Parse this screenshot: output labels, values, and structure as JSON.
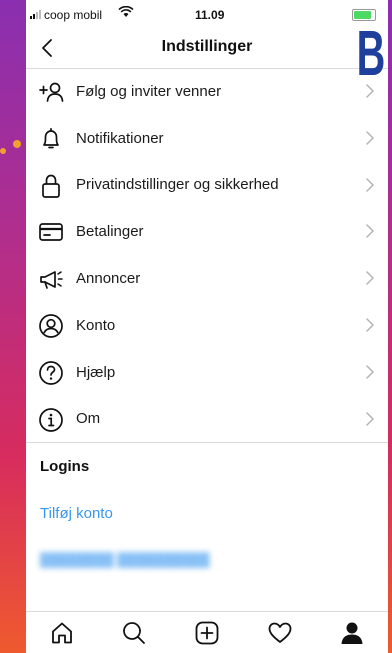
{
  "status_bar": {
    "carrier": "coop mobil",
    "time": "11.09"
  },
  "header": {
    "title": "Indstillinger"
  },
  "menu": [
    {
      "label": "Følg og inviter venner",
      "icon": "add-person-icon"
    },
    {
      "label": "Notifikationer",
      "icon": "bell-icon"
    },
    {
      "label": "Privatindstillinger og sikkerhed",
      "icon": "lock-icon"
    },
    {
      "label": "Betalinger",
      "icon": "credit-card-icon"
    },
    {
      "label": "Annoncer",
      "icon": "megaphone-icon"
    },
    {
      "label": "Konto",
      "icon": "account-icon"
    },
    {
      "label": "Hjælp",
      "icon": "help-icon"
    },
    {
      "label": "Om",
      "icon": "info-icon"
    }
  ],
  "logins": {
    "heading": "Logins",
    "add_account": "Tilføj konto"
  },
  "tab_bar": [
    "home-icon",
    "search-icon",
    "new-post-icon",
    "activity-heart-icon",
    "profile-icon"
  ],
  "overlay": {
    "badge": "B"
  },
  "colors": {
    "link": "#3897f0",
    "badge": "#1f3f9c",
    "dot": "#f0a12e"
  }
}
